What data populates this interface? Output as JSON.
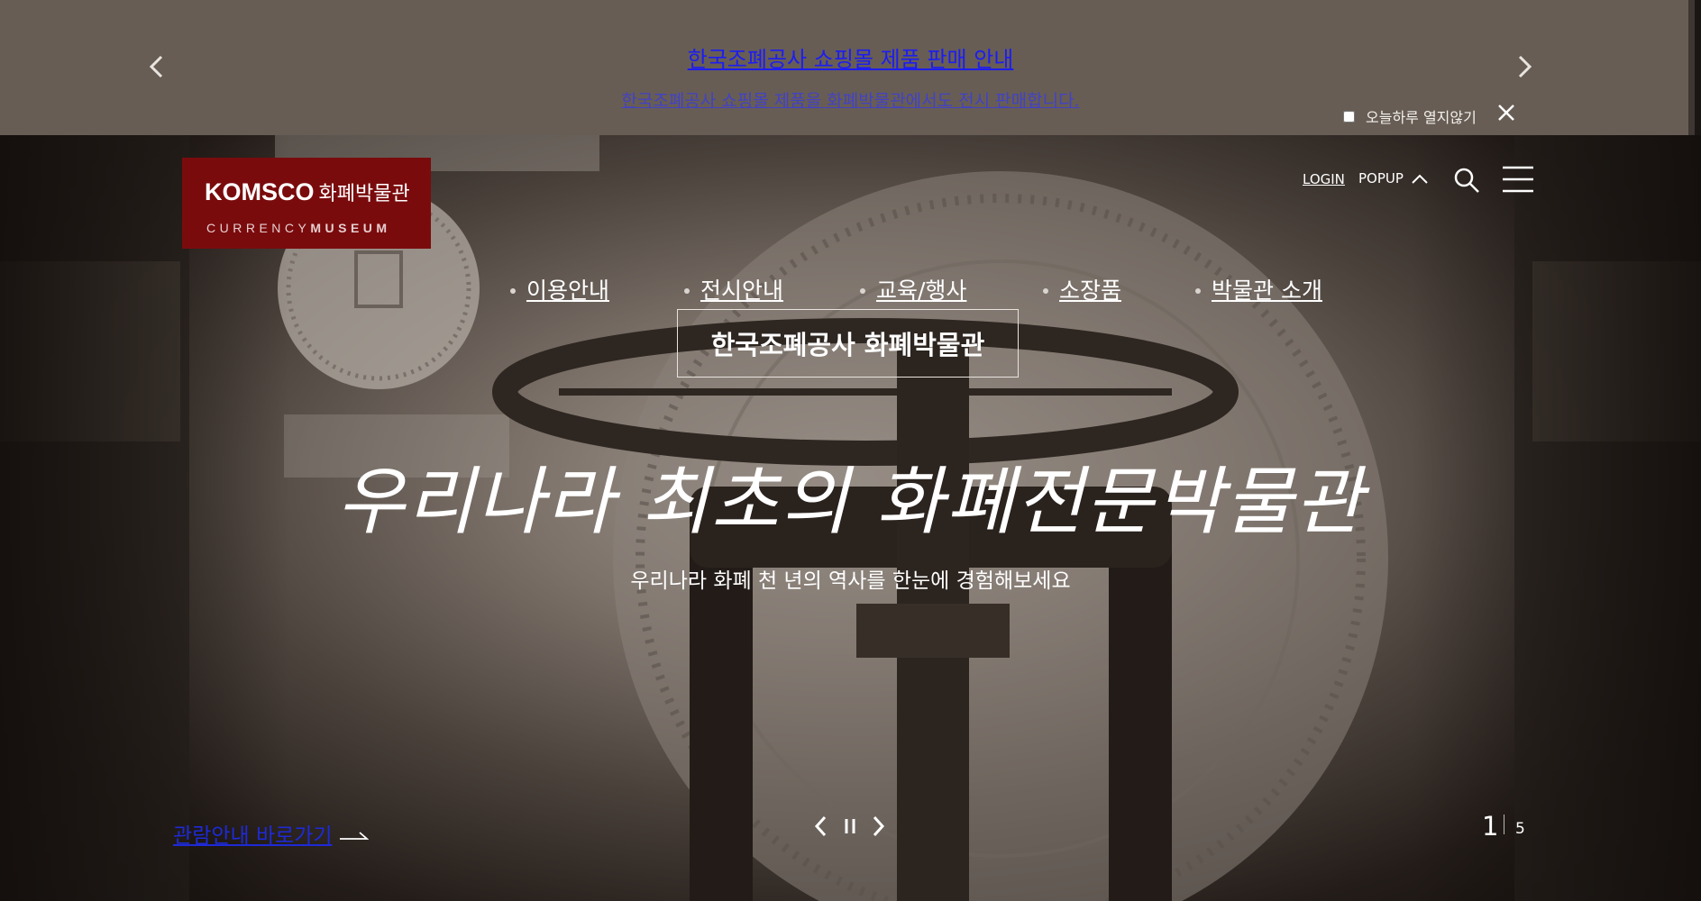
{
  "popup": {
    "title": "한국조폐공사 쇼핑몰 제품 판매 안내",
    "description": "한국조폐공사 쇼핑몰 제품을 화폐박물관에서도 전시 판매합니다.",
    "today_label": "오늘하루 열지않기",
    "prev_icon": "chevron-left-icon",
    "next_icon": "chevron-right-icon",
    "close_icon": "close-icon"
  },
  "header": {
    "logo_brand": "KOMSCO",
    "logo_korean": "화폐박물관",
    "logo_english_1": "CURRENCY",
    "logo_english_2": "MUSEUM",
    "login": "LOGIN",
    "popup_toggle": "POPUP",
    "search_icon": "search-icon",
    "menu_icon": "menu-icon"
  },
  "nav": {
    "items": [
      {
        "label": "이용안내"
      },
      {
        "label": "전시안내"
      },
      {
        "label": "교육/행사"
      },
      {
        "label": "소장품"
      },
      {
        "label": "박물관 소개"
      }
    ]
  },
  "hero": {
    "tag": "한국조폐공사 화폐박물관",
    "headline": "우리나라 최초의 화폐전문박물관",
    "subline": "우리나라 화폐 천 년의 역사를 한눈에 경험해보세요",
    "guide_link": "관람안내 바로가기",
    "slide_current": "1",
    "slide_total": "5"
  },
  "colors": {
    "popup_bg": "#675d55",
    "logo_bg": "#7a0b0d",
    "link_blue": "#1d1df2"
  }
}
